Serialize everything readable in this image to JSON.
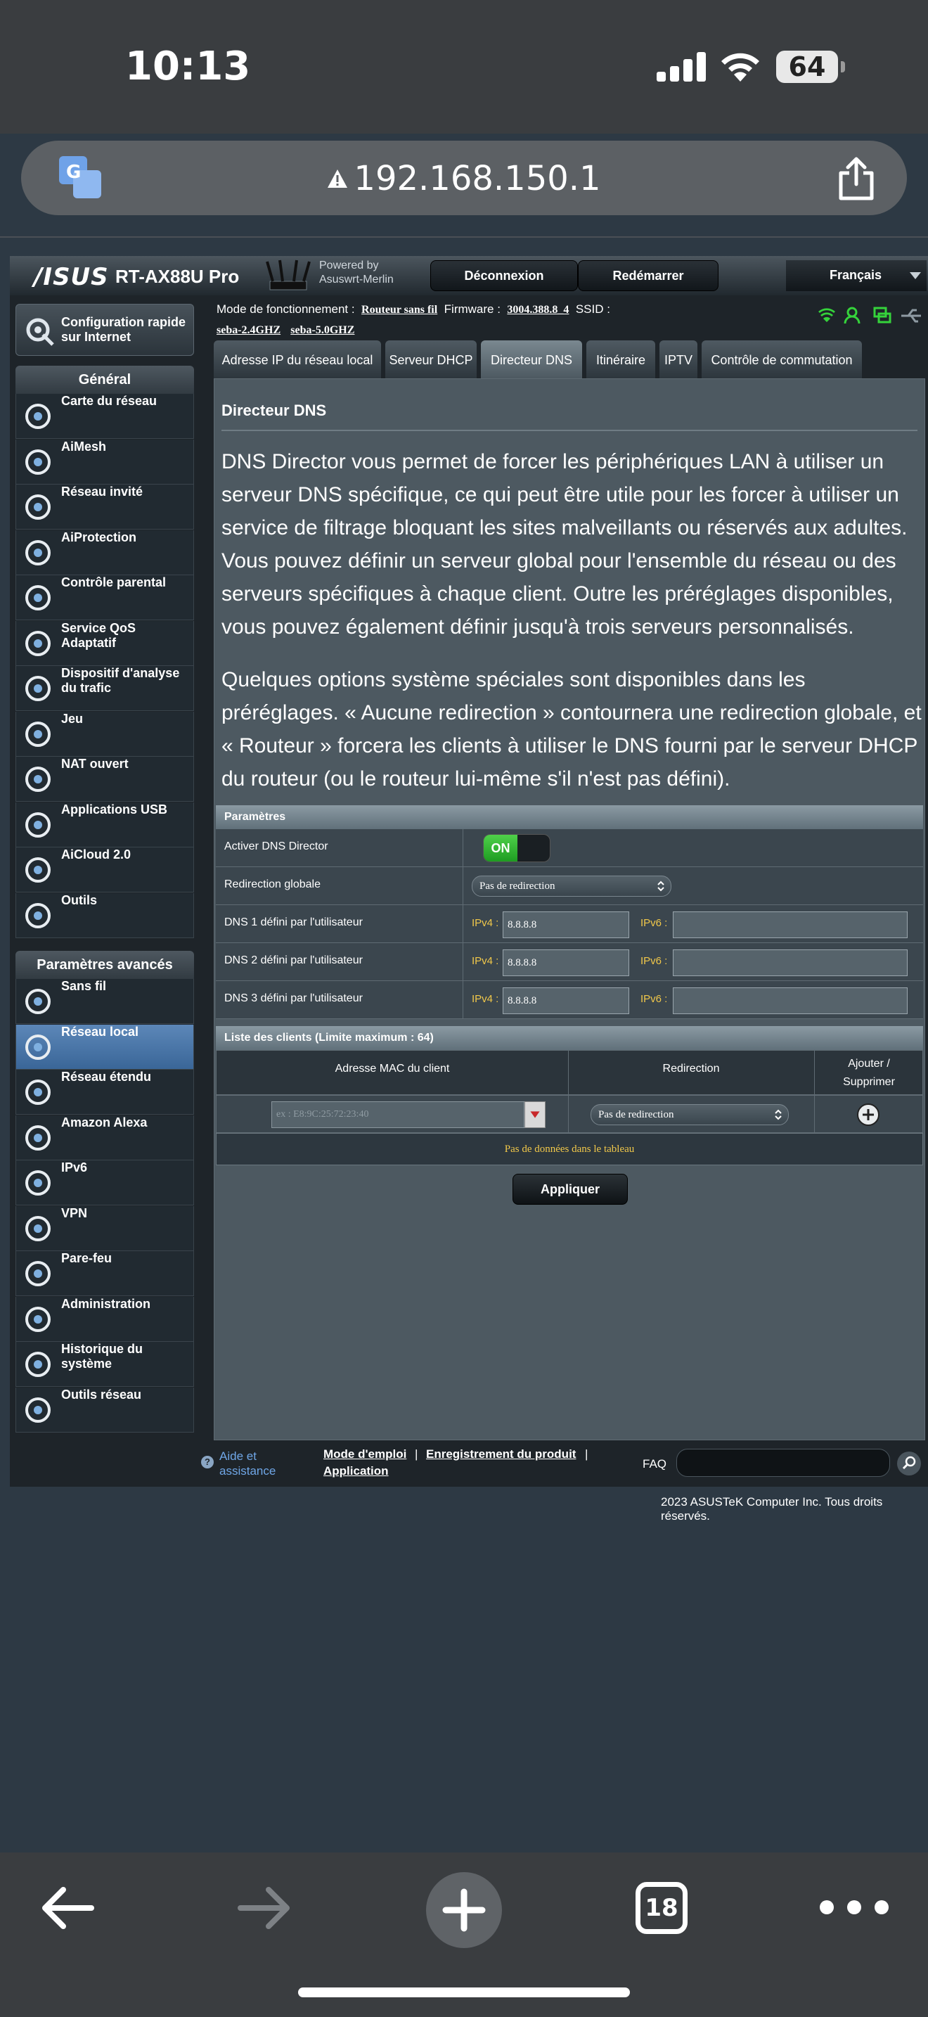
{
  "status_bar": {
    "time": "10:13",
    "battery": "64"
  },
  "browser": {
    "url": "192.168.150.1",
    "tab_count": "18"
  },
  "router": {
    "brand": "/ISUS",
    "model": "RT-AX88U Pro",
    "powered_by_line1": "Powered by",
    "powered_by_line2": "Asuswrt-Merlin",
    "logout": "Déconnexion",
    "reboot": "Redémarrer",
    "language": "Français"
  },
  "info": {
    "mode_label": "Mode de fonctionnement :",
    "mode_value": "Routeur sans fil",
    "firmware_label": "Firmware :",
    "firmware_value": "3004.388.8_4",
    "ssid_label": "SSID :",
    "ssid_1": "seba-2.4GHZ",
    "ssid_2": "seba-5.0GHZ"
  },
  "menu": {
    "quick_setup": "Configuration rapide sur Internet",
    "general_head": "Général",
    "general": [
      "Carte du réseau",
      "AiMesh",
      "Réseau invité",
      "AiProtection",
      "Contrôle parental",
      "Service QoS Adaptatif",
      "Dispositif d'analyse du trafic",
      "Jeu",
      "NAT ouvert",
      "Applications USB",
      "AiCloud 2.0",
      "Outils"
    ],
    "advanced_head": "Paramètres avancés",
    "advanced": [
      "Sans fil",
      "Réseau local",
      "Réseau étendu",
      "Amazon Alexa",
      "IPv6",
      "VPN",
      "Pare-feu",
      "Administration",
      "Historique du système",
      "Outils réseau"
    ]
  },
  "tabs": [
    "Adresse IP du réseau local",
    "Serveur DHCP",
    "Directeur DNS",
    "Itinéraire",
    "IPTV",
    "Contrôle de commutation"
  ],
  "page": {
    "title": "Directeur DNS",
    "desc1": "DNS Director vous permet de forcer les périphériques LAN à utiliser un serveur DNS spécifique, ce qui peut être utile pour les forcer à utiliser un service de filtrage bloquant les sites malveillants ou réservés aux adultes. Vous pouvez définir un serveur global pour l'ensemble du réseau ou des serveurs spécifiques à chaque client. Outre les préréglages disponibles, vous pouvez également définir jusqu'à trois serveurs personnalisés.",
    "desc2": "Quelques options système spéciales sont disponibles dans les préréglages. « Aucune redirection » contournera une redirection globale, et « Routeur » forcera les clients à utiliser le DNS fourni par le serveur DHCP du routeur (ou le routeur lui-même s'il n'est pas défini).",
    "params_head": "Paramètres",
    "enable_label": "Activer DNS Director",
    "enable_state": "ON",
    "global_label": "Redirection globale",
    "global_value": "Pas de redirection",
    "ipv4_label": "IPv4 :",
    "ipv6_label": "IPv6 :",
    "dns_rows": [
      {
        "label": "DNS 1 défini par l'utilisateur",
        "ipv4": "8.8.8.8",
        "ipv6": ""
      },
      {
        "label": "DNS 2 défini par l'utilisateur",
        "ipv4": "8.8.8.8",
        "ipv6": ""
      },
      {
        "label": "DNS 3 défini par l'utilisateur",
        "ipv4": "8.8.8.8",
        "ipv6": ""
      }
    ],
    "clients_head": "Liste des clients (Limite maximum : 64)",
    "col_mac": "Adresse MAC du client",
    "col_redirect": "Redirection",
    "col_addremove_1": "Ajouter /",
    "col_addremove_2": "Supprimer",
    "mac_placeholder": "ex : E8:9C:25:72:23:40",
    "client_redirect": "Pas de redirection",
    "no_data": "Pas de données dans le tableau",
    "apply": "Appliquer"
  },
  "footer": {
    "help_1": "Aide et",
    "help_2": "assistance",
    "manual": "Mode d'emploi",
    "registration": "Enregistrement du produit",
    "application": "Application",
    "faq": "FAQ",
    "copyright": "2023 ASUSTeK Computer Inc. Tous droits réservés."
  },
  "colors": {
    "accent_active": "#4a77aa",
    "on_green": "#2fb52c",
    "label_yellow": "#f1c84a"
  }
}
